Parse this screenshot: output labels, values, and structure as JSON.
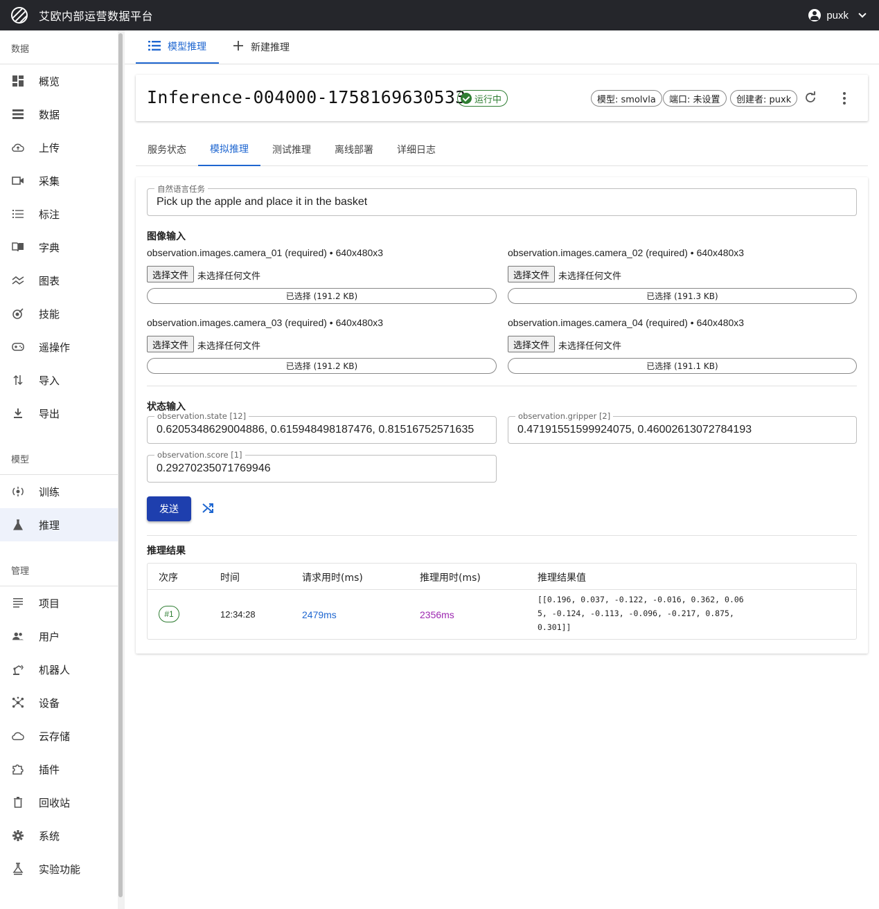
{
  "app": {
    "title": "艾欧内部运营数据平台",
    "user": "puxk"
  },
  "sidebar": {
    "sections": [
      {
        "title": "数据",
        "items": [
          {
            "label": "概览",
            "icon": "dashboard-icon"
          },
          {
            "label": "数据",
            "icon": "list-icon"
          },
          {
            "label": "上传",
            "icon": "cloud-upload-icon"
          },
          {
            "label": "采集",
            "icon": "video-icon"
          },
          {
            "label": "标注",
            "icon": "annotate-icon"
          },
          {
            "label": "字典",
            "icon": "book-icon"
          },
          {
            "label": "图表",
            "icon": "chart-icon"
          },
          {
            "label": "技能",
            "icon": "skill-icon"
          },
          {
            "label": "遥操作",
            "icon": "gamepad-icon"
          },
          {
            "label": "导入",
            "icon": "import-icon"
          },
          {
            "label": "导出",
            "icon": "download-icon"
          }
        ]
      },
      {
        "title": "模型",
        "items": [
          {
            "label": "训练",
            "icon": "train-icon"
          },
          {
            "label": "推理",
            "icon": "flask-icon"
          }
        ]
      },
      {
        "title": "管理",
        "items": [
          {
            "label": "项目",
            "icon": "project-icon"
          },
          {
            "label": "用户",
            "icon": "users-icon"
          },
          {
            "label": "机器人",
            "icon": "robot-arm-icon"
          },
          {
            "label": "设备",
            "icon": "device-icon"
          },
          {
            "label": "云存储",
            "icon": "cloud-icon"
          },
          {
            "label": "插件",
            "icon": "puzzle-icon"
          },
          {
            "label": "回收站",
            "icon": "trash-icon"
          },
          {
            "label": "系统",
            "icon": "gear-icon"
          },
          {
            "label": "实验功能",
            "icon": "experiment-icon"
          }
        ]
      }
    ]
  },
  "toptabs": [
    {
      "label": "模型推理"
    },
    {
      "label": "新建推理"
    }
  ],
  "inference": {
    "title": "Inference-004000-1758169630533",
    "status": "运行中",
    "chips": [
      "模型: smolvla",
      "端口: 未设置",
      "创建者: puxk"
    ]
  },
  "subtabs": [
    "服务状态",
    "模拟推理",
    "测试推理",
    "离线部署",
    "详细日志"
  ],
  "task": {
    "label": "自然语言任务",
    "value": "Pick up the apple and place it in the basket"
  },
  "image_input": {
    "title": "图像输入",
    "button_label": "选择文件",
    "no_file_text": "未选择任何文件",
    "cameras": [
      {
        "label": "observation.images.camera_01 (required) • 640x480x3",
        "selected": "已选择 (191.2 KB)"
      },
      {
        "label": "observation.images.camera_02 (required) • 640x480x3",
        "selected": "已选择 (191.3 KB)"
      },
      {
        "label": "observation.images.camera_03 (required) • 640x480x3",
        "selected": "已选择 (191.2 KB)"
      },
      {
        "label": "observation.images.camera_04 (required) • 640x480x3",
        "selected": "已选择 (191.1 KB)"
      }
    ]
  },
  "state_input": {
    "title": "状态输入",
    "fields": [
      {
        "label": "observation.state [12]",
        "value": "0.6205348629004886, 0.615948498187476, 0.81516752571635"
      },
      {
        "label": "observation.gripper [2]",
        "value": "0.47191551599924075, 0.46002613072784193"
      },
      {
        "label": "observation.score [1]",
        "value": "0.29270235071769946"
      }
    ]
  },
  "actions": {
    "send_label": "发送"
  },
  "results": {
    "title": "推理结果",
    "columns": [
      "次序",
      "时间",
      "请求用时(ms)",
      "推理用时(ms)",
      "推理结果值"
    ],
    "rows": [
      {
        "seq": "#1",
        "time": "12:34:28",
        "request_ms": "2479ms",
        "infer_ms": "2356ms",
        "value": "[[0.196, 0.037, -0.122, -0.016, 0.362, 0.065, -0.124, -0.113, -0.096, -0.217, 0.875, 0.301]]"
      }
    ]
  },
  "colors": {
    "accent": "#1e66d0",
    "topbar": "#25262b",
    "success": "#2e7d32",
    "send_button": "#1e3fae",
    "request_ms": "#1e66d0",
    "infer_ms": "#9c27b0"
  }
}
